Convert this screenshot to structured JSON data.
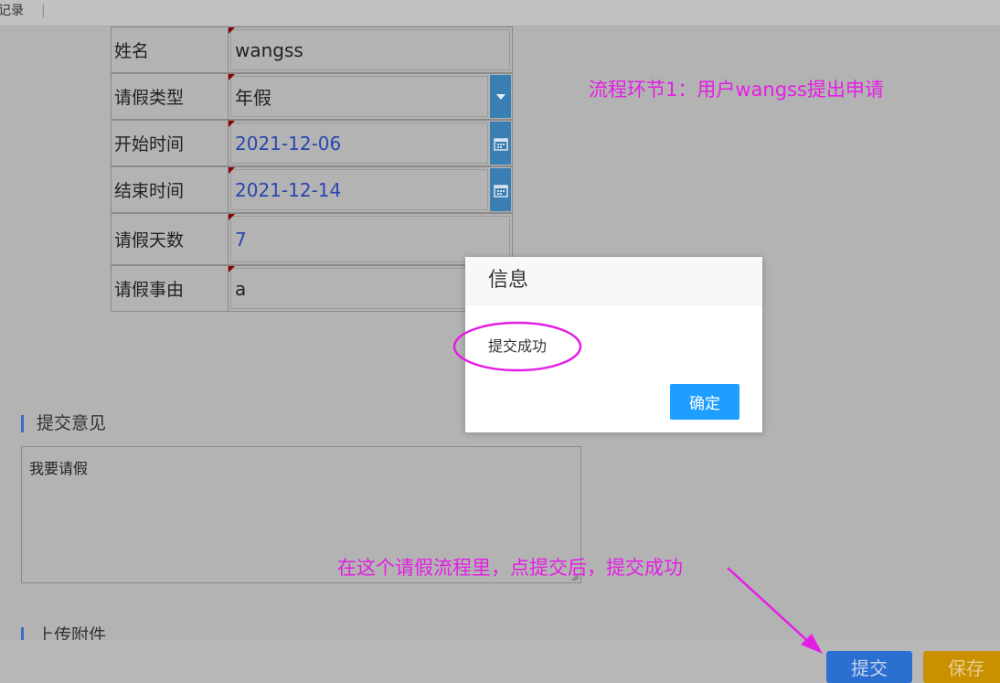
{
  "topbar": {
    "tab_label": "记录",
    "separator": "|"
  },
  "form": {
    "rows": [
      {
        "label": "姓名",
        "value": "wangss"
      },
      {
        "label": "请假类型",
        "value": "年假"
      },
      {
        "label": "开始时间",
        "value": "2021-12-06"
      },
      {
        "label": "结束时间",
        "value": "2021-12-14"
      },
      {
        "label": "请假天数",
        "value": "7"
      },
      {
        "label": "请假事由",
        "value": "a"
      }
    ]
  },
  "sections": {
    "opinion_title": "提交意见",
    "opinion_text": "我要请假",
    "attachment_title": "上传附件"
  },
  "annotations": {
    "step_note": "流程环节1：用户wangss提出申请",
    "submit_note": "在这个请假流程里，点提交后，提交成功"
  },
  "dialog": {
    "title": "信息",
    "message": "提交成功",
    "ok_label": "确定"
  },
  "actions": {
    "submit_label": "提交",
    "save_label": "保存"
  },
  "colors": {
    "annotation": "#e51ee5",
    "primary": "#1e9fff",
    "submit": "#2b6fd1",
    "save": "#c99100"
  }
}
